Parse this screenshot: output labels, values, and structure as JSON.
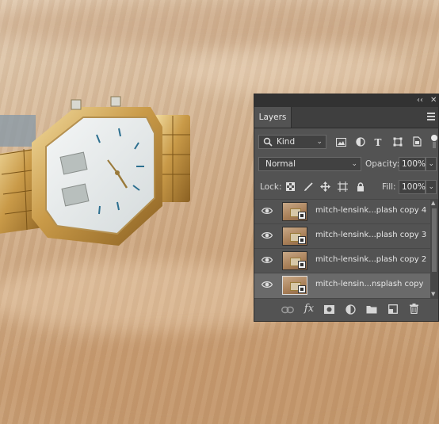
{
  "panel": {
    "title_buttons": {
      "collapse": "‹‹",
      "close": "✕"
    },
    "tab_label": "Layers",
    "filter": {
      "value": "Kind"
    },
    "blend_mode": {
      "value": "Normal"
    },
    "opacity": {
      "label": "Opacity:",
      "value": "100%"
    },
    "lock_label": "Lock:",
    "fill": {
      "label": "Fill:",
      "value": "100%"
    },
    "layers": [
      {
        "name": "mitch-lensink...plash copy 4",
        "selected": false
      },
      {
        "name": "mitch-lensink...plash copy 3",
        "selected": false
      },
      {
        "name": "mitch-lensink...plash copy 2",
        "selected": false
      },
      {
        "name": "mitch-lensin...nsplash copy",
        "selected": true
      }
    ],
    "bottom_icons": [
      "link-icon",
      "fx-icon",
      "mask-icon",
      "adjustment-icon",
      "folder-icon",
      "new-layer-icon",
      "trash-icon"
    ],
    "fx_label": "fx"
  },
  "colors": {
    "panel_bg": "#535353",
    "titlebar_bg": "#323232",
    "selected_layer": "#6a6a6a"
  }
}
